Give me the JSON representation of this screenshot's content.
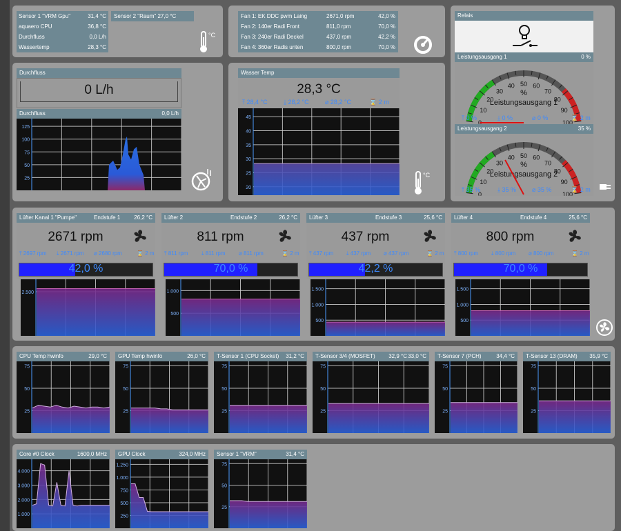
{
  "sensors_panel": {
    "rows": [
      {
        "label": "Sensor 1 \"VRM Gpu\"",
        "value": "31,4 °C"
      },
      {
        "label": "aquaero CPU",
        "value": "36,8 °C"
      },
      {
        "label": "Durchfluss",
        "value": "0,0 L/h"
      },
      {
        "label": "Wassertemp",
        "value": "28,3 °C"
      }
    ],
    "extra_label": "Sensor 2 \"Raum\" 27,0 °C"
  },
  "fans_panel": {
    "rows": [
      {
        "label": "Fan 1:  EK DDC pwm Laing",
        "rpm": "2671,0 rpm",
        "pct": "42,0 %"
      },
      {
        "label": "Fan 2:  140er Radi Front",
        "rpm": "811,0 rpm",
        "pct": "70,0 %"
      },
      {
        "label": "Fan 3:  240er Radi Deckel",
        "rpm": "437,0 rpm",
        "pct": "42,2 %"
      },
      {
        "label": "Fan 4:  360er Radis unten",
        "rpm": "800,0 rpm",
        "pct": "70,0 %"
      }
    ]
  },
  "relais": {
    "title": "Relais"
  },
  "flow": {
    "title": "Durchfluss",
    "value": "0 L/h",
    "chart_title": "Durchfluss",
    "chart_value": "0,0 L/h",
    "chart_data": {
      "type": "area",
      "y_ticks": [
        "125",
        "100",
        "75",
        "50",
        "25"
      ],
      "ylim": [
        0,
        140
      ],
      "values": [
        0,
        0,
        0,
        0,
        0,
        0,
        0,
        0,
        0,
        0,
        0,
        0,
        0,
        0,
        0,
        0,
        0,
        0,
        0,
        0,
        0,
        0,
        0,
        0,
        0,
        0,
        0,
        0,
        0,
        0,
        0,
        0,
        0,
        0,
        0,
        0,
        0,
        0,
        0,
        0,
        0,
        0,
        0,
        0,
        0,
        0,
        0,
        0,
        0,
        0,
        0,
        0,
        0,
        0,
        0,
        0,
        0,
        0,
        0,
        0,
        0,
        0,
        0,
        0,
        0,
        0,
        0,
        0,
        0,
        0,
        0,
        0,
        0,
        0,
        0,
        0,
        0,
        0,
        0,
        0,
        0,
        0,
        0,
        0,
        0,
        0,
        0,
        0,
        0,
        0,
        0,
        0,
        0,
        0,
        0,
        0,
        0,
        0,
        0,
        0,
        0,
        0,
        0,
        0,
        0,
        0,
        0,
        0,
        0,
        0,
        0,
        0,
        0,
        0,
        0,
        0,
        0,
        0,
        0,
        0,
        0,
        0,
        0,
        0,
        0,
        0,
        0,
        0,
        0,
        0,
        0,
        0,
        0,
        0,
        0,
        0,
        0,
        0,
        0,
        0,
        0,
        0,
        0,
        0,
        0,
        0,
        0,
        0,
        0,
        0,
        0,
        0,
        0,
        0,
        0,
        0,
        0,
        0,
        0,
        0,
        0,
        0,
        0,
        0,
        0,
        0,
        0,
        0,
        0,
        0,
        0,
        0,
        0,
        0,
        0,
        0,
        0,
        0,
        0,
        0,
        0,
        0,
        0,
        0,
        0,
        0,
        0,
        0,
        0,
        0,
        0,
        0,
        0,
        0,
        0,
        0,
        0,
        0,
        0,
        0,
        0,
        0,
        0,
        0,
        0,
        0,
        0,
        0,
        0,
        0,
        0,
        0,
        0,
        0,
        0,
        0,
        0,
        0,
        0,
        0,
        0,
        0,
        0,
        0,
        0,
        0,
        0,
        0,
        0,
        0,
        0,
        0,
        0,
        0,
        0,
        0,
        0
      ]
    }
  },
  "water": {
    "title": "Wasser Temp",
    "value": "28,3 °C",
    "stats": [
      "28,4 °C",
      "28,2 °C",
      "28,2 °C",
      "2 m"
    ],
    "chart_data": {
      "type": "area",
      "y_ticks": [
        "45",
        "40",
        "35",
        "30",
        "25",
        "20"
      ],
      "ylim": [
        17,
        48
      ],
      "value": 28.3
    }
  },
  "outputs": [
    {
      "title": "Leistungsausgang 1",
      "value": "0 %",
      "pct": 0,
      "center_label": "Leistungsausgang 1",
      "stats": [
        "0 %",
        "0 %",
        "0 %",
        "2 m"
      ]
    },
    {
      "title": "Leistungsausgang 2",
      "value": "35 %",
      "pct": 35,
      "center_label": "Leistungsausgang 2",
      "stats": [
        "35 %",
        "35 %",
        "35 %",
        "2 m"
      ]
    }
  ],
  "gauge_scale": [
    "0",
    "10",
    "20",
    "30",
    "40",
    "50",
    "60",
    "70",
    "80",
    "90",
    "100"
  ],
  "gauge_unit": "%",
  "fans": [
    {
      "title": "Lüfter Kanal 1 \"Pumpe\"",
      "stage": "Endstufe 1",
      "temp": "26,2 °C",
      "rpm": "2671 rpm",
      "stats": [
        "2697 rpm",
        "2671 rpm",
        "2680 rpm",
        "2 m"
      ],
      "pct_label": "42,0 %",
      "pct": 42.0,
      "chart_data": {
        "type": "area",
        "y_ticks": [
          "2.500"
        ],
        "value": 2671
      }
    },
    {
      "title": "Lüfter 2",
      "stage": "Endstufe 2",
      "temp": "26,2 °C",
      "rpm": "811 rpm",
      "stats": [
        "811 rpm",
        "811 rpm",
        "811 rpm",
        "2 m"
      ],
      "pct_label": "70,0 %",
      "pct": 70.0,
      "chart_data": {
        "type": "area",
        "y_ticks": [
          "1.000",
          "500"
        ],
        "value": 811
      }
    },
    {
      "title": "Lüfter 3",
      "stage": "Endstufe 3",
      "temp": "25,6 °C",
      "rpm": "437 rpm",
      "stats": [
        "437 rpm",
        "437 rpm",
        "437 rpm",
        "2 m"
      ],
      "pct_label": "42,2 %",
      "pct": 42.2,
      "chart_data": {
        "type": "area",
        "y_ticks": [
          "1.500",
          "1.000",
          "500"
        ],
        "value": 437
      }
    },
    {
      "title": "Lüfter 4",
      "stage": "Endstufe 4",
      "temp": "25,6 °C",
      "rpm": "800 rpm",
      "stats": [
        "800 rpm",
        "800 rpm",
        "800 rpm",
        "2 m"
      ],
      "pct_label": "70,0 %",
      "pct": 70.0,
      "chart_data": {
        "type": "area",
        "y_ticks": [
          "1.500",
          "1.000",
          "500"
        ],
        "value": 800
      }
    }
  ],
  "temp_charts": [
    {
      "title": "CPU Temp hwinfo",
      "value": "29,0 °C",
      "chart_data": {
        "type": "line",
        "y_ticks": [
          "75",
          "50",
          "25"
        ],
        "ylim": [
          0,
          80
        ],
        "values": [
          28,
          31,
          30,
          29,
          31,
          29,
          28,
          30,
          29,
          28,
          29,
          29,
          28,
          29
        ]
      }
    },
    {
      "title": "GPU Temp hwinfo",
      "value": "26,0 °C",
      "chart_data": {
        "type": "line",
        "y_ticks": [
          "75",
          "50",
          "25"
        ],
        "ylim": [
          0,
          80
        ],
        "values": [
          28,
          28,
          28,
          28,
          28,
          27,
          27,
          26,
          26,
          26,
          26,
          26,
          26,
          26
        ]
      }
    },
    {
      "title": "T-Sensor 1 (CPU Socket)",
      "value": "31,2 °C",
      "chart_data": {
        "type": "line",
        "y_ticks": [
          "75",
          "50",
          "25"
        ],
        "ylim": [
          0,
          80
        ],
        "values": [
          31,
          31,
          31,
          31,
          31,
          31,
          31,
          31,
          31,
          31,
          31,
          31,
          31,
          31
        ]
      }
    },
    {
      "title": "T-Sensor 3/4 (MOSFET)",
      "value": "32,9 °C",
      "value2": "33,0 °C",
      "chart_data": {
        "type": "line",
        "y_ticks": [
          "75",
          "50",
          "25"
        ],
        "ylim": [
          0,
          80
        ],
        "values": [
          33,
          33,
          33,
          33,
          33,
          33,
          33,
          33,
          33,
          33,
          33,
          33,
          33,
          33
        ]
      }
    },
    {
      "title": "T-Sensor 7 (PCH)",
      "value": "34,4 °C",
      "chart_data": {
        "type": "line",
        "y_ticks": [
          "75",
          "50",
          "25"
        ],
        "ylim": [
          0,
          80
        ],
        "values": [
          34,
          34,
          34,
          34,
          34,
          34,
          34,
          34,
          34,
          34,
          34,
          34,
          34,
          34
        ]
      }
    },
    {
      "title": "T-Sensor 13 (DRAM)",
      "value": "35,9 °C",
      "chart_data": {
        "type": "line",
        "y_ticks": [
          "75",
          "50",
          "25"
        ],
        "ylim": [
          0,
          80
        ],
        "values": [
          36,
          36,
          36,
          36,
          36,
          36,
          36,
          36,
          36,
          36,
          36,
          36,
          36,
          36
        ]
      }
    }
  ],
  "clock_charts": [
    {
      "title": "Core #0 Clock",
      "value": "1600,0 MHz",
      "chart_data": {
        "type": "area",
        "y_ticks": [
          "4.000",
          "3.000",
          "2.000",
          "1.000"
        ],
        "ylim": [
          0,
          4800
        ],
        "values": [
          1600,
          1700,
          4500,
          4400,
          1600,
          1550,
          3200,
          1600,
          1550,
          4000,
          1600,
          1550,
          1600,
          1600,
          1600,
          1600,
          1600,
          1600,
          1600,
          1600
        ]
      }
    },
    {
      "title": "GPU Clock",
      "value": "324,0 MHz",
      "chart_data": {
        "type": "area",
        "y_ticks": [
          "1.250",
          "1.000",
          "750",
          "500",
          "250"
        ],
        "ylim": [
          0,
          1350
        ],
        "values": [
          870,
          870,
          600,
          600,
          330,
          324,
          324,
          324,
          324,
          324,
          324,
          324,
          324,
          324,
          324,
          324,
          324,
          324,
          324,
          324
        ]
      }
    },
    {
      "title": "Sensor 1 \"VRM\"",
      "value": "31,4 °C",
      "chart_data": {
        "type": "area",
        "y_ticks": [
          "75",
          "50",
          "25"
        ],
        "ylim": [
          0,
          80
        ],
        "values": [
          32,
          32,
          32,
          31,
          31,
          31,
          31,
          31,
          31,
          31,
          31,
          31,
          31,
          31
        ]
      }
    }
  ]
}
